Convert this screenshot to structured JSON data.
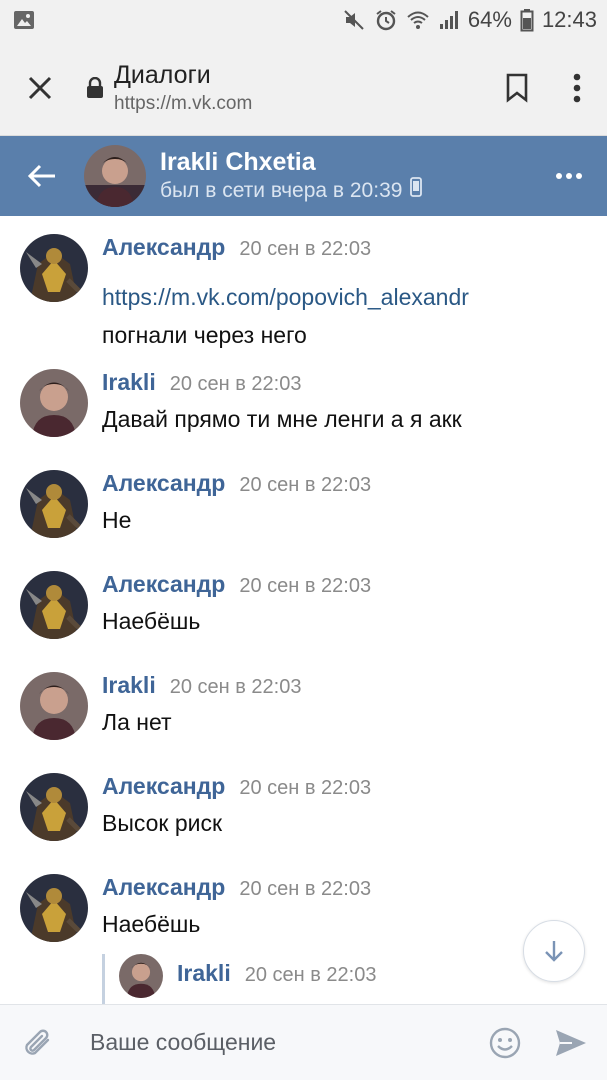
{
  "status_bar": {
    "battery": "64%",
    "time": "12:43"
  },
  "browser": {
    "page_title": "Диалоги",
    "url": "https://m.vk.com"
  },
  "chat_header": {
    "name": "Irakli Chxetia",
    "status": "был в сети вчера в 20:39"
  },
  "messages": [
    {
      "author": "Александр",
      "time": "20 сен в 22:03",
      "lines": [
        "https://m.vk.com/popovich_alexandr",
        "погнали через него"
      ],
      "link_first": true,
      "avatar": "alexandr-avatar"
    },
    {
      "author": "Irakli",
      "time": "20 сен в 22:03",
      "lines": [
        "Давай прямо ти мне ленги а я акк"
      ],
      "avatar": "irakli-avatar"
    },
    {
      "author": "Александр",
      "time": "20 сен в 22:03",
      "lines": [
        "Не"
      ],
      "avatar": "alexandr-avatar"
    },
    {
      "author": "Александр",
      "time": "20 сен в 22:03",
      "lines": [
        "Наебёшь"
      ],
      "avatar": "alexandr-avatar"
    },
    {
      "author": "Irakli",
      "time": "20 сен в 22:03",
      "lines": [
        "Ла нет"
      ],
      "avatar": "irakli-avatar"
    },
    {
      "author": "Александр",
      "time": "20 сен в 22:03",
      "lines": [
        "Высок риск"
      ],
      "avatar": "alexandr-avatar"
    },
    {
      "author": "Александр",
      "time": "20 сен в 22:03",
      "lines": [
        "Наебёшь"
      ],
      "avatar": "alexandr-avatar"
    }
  ],
  "forwarded": {
    "author": "Irakli",
    "time": "20 сен в 22:03"
  },
  "composer": {
    "placeholder": "Ваше сообщение"
  },
  "colors": {
    "header_bg": "#5a7fab",
    "author": "#3f6597",
    "link": "#2a5885"
  }
}
